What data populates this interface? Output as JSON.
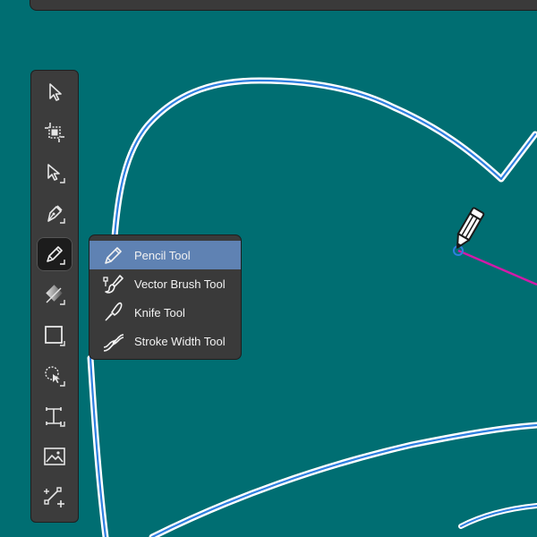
{
  "canvas": {
    "background": "#006e72",
    "path_color": "#2f7fe0",
    "path_glow": "#ffffff",
    "segment_color": "#d21aa8"
  },
  "toolbar": {
    "tools": [
      {
        "name": "selection-tool",
        "icon": "arrow-icon"
      },
      {
        "name": "artboard-tool",
        "icon": "artboard-icon"
      },
      {
        "name": "direct-selection-tool",
        "icon": "hollow-arrow-icon"
      },
      {
        "name": "pen-tool",
        "icon": "pen-nib-icon"
      },
      {
        "name": "pencil-tool",
        "icon": "pencil-icon",
        "active": true
      },
      {
        "name": "gradient-tool",
        "icon": "gradient-icon"
      },
      {
        "name": "rectangle-tool",
        "icon": "rectangle-icon"
      },
      {
        "name": "shape-builder-tool",
        "icon": "shape-builder-icon"
      },
      {
        "name": "type-tool",
        "icon": "type-frame-icon"
      },
      {
        "name": "place-image-tool",
        "icon": "image-icon"
      },
      {
        "name": "free-transform-tool",
        "icon": "transform-icon"
      }
    ]
  },
  "flyout": {
    "items": [
      {
        "label": "Pencil Tool",
        "icon": "pencil-icon",
        "selected": true
      },
      {
        "label": "Vector Brush Tool",
        "icon": "vector-brush-icon"
      },
      {
        "label": "Knife Tool",
        "icon": "knife-icon"
      },
      {
        "label": "Stroke Width Tool",
        "icon": "stroke-width-icon"
      }
    ]
  }
}
